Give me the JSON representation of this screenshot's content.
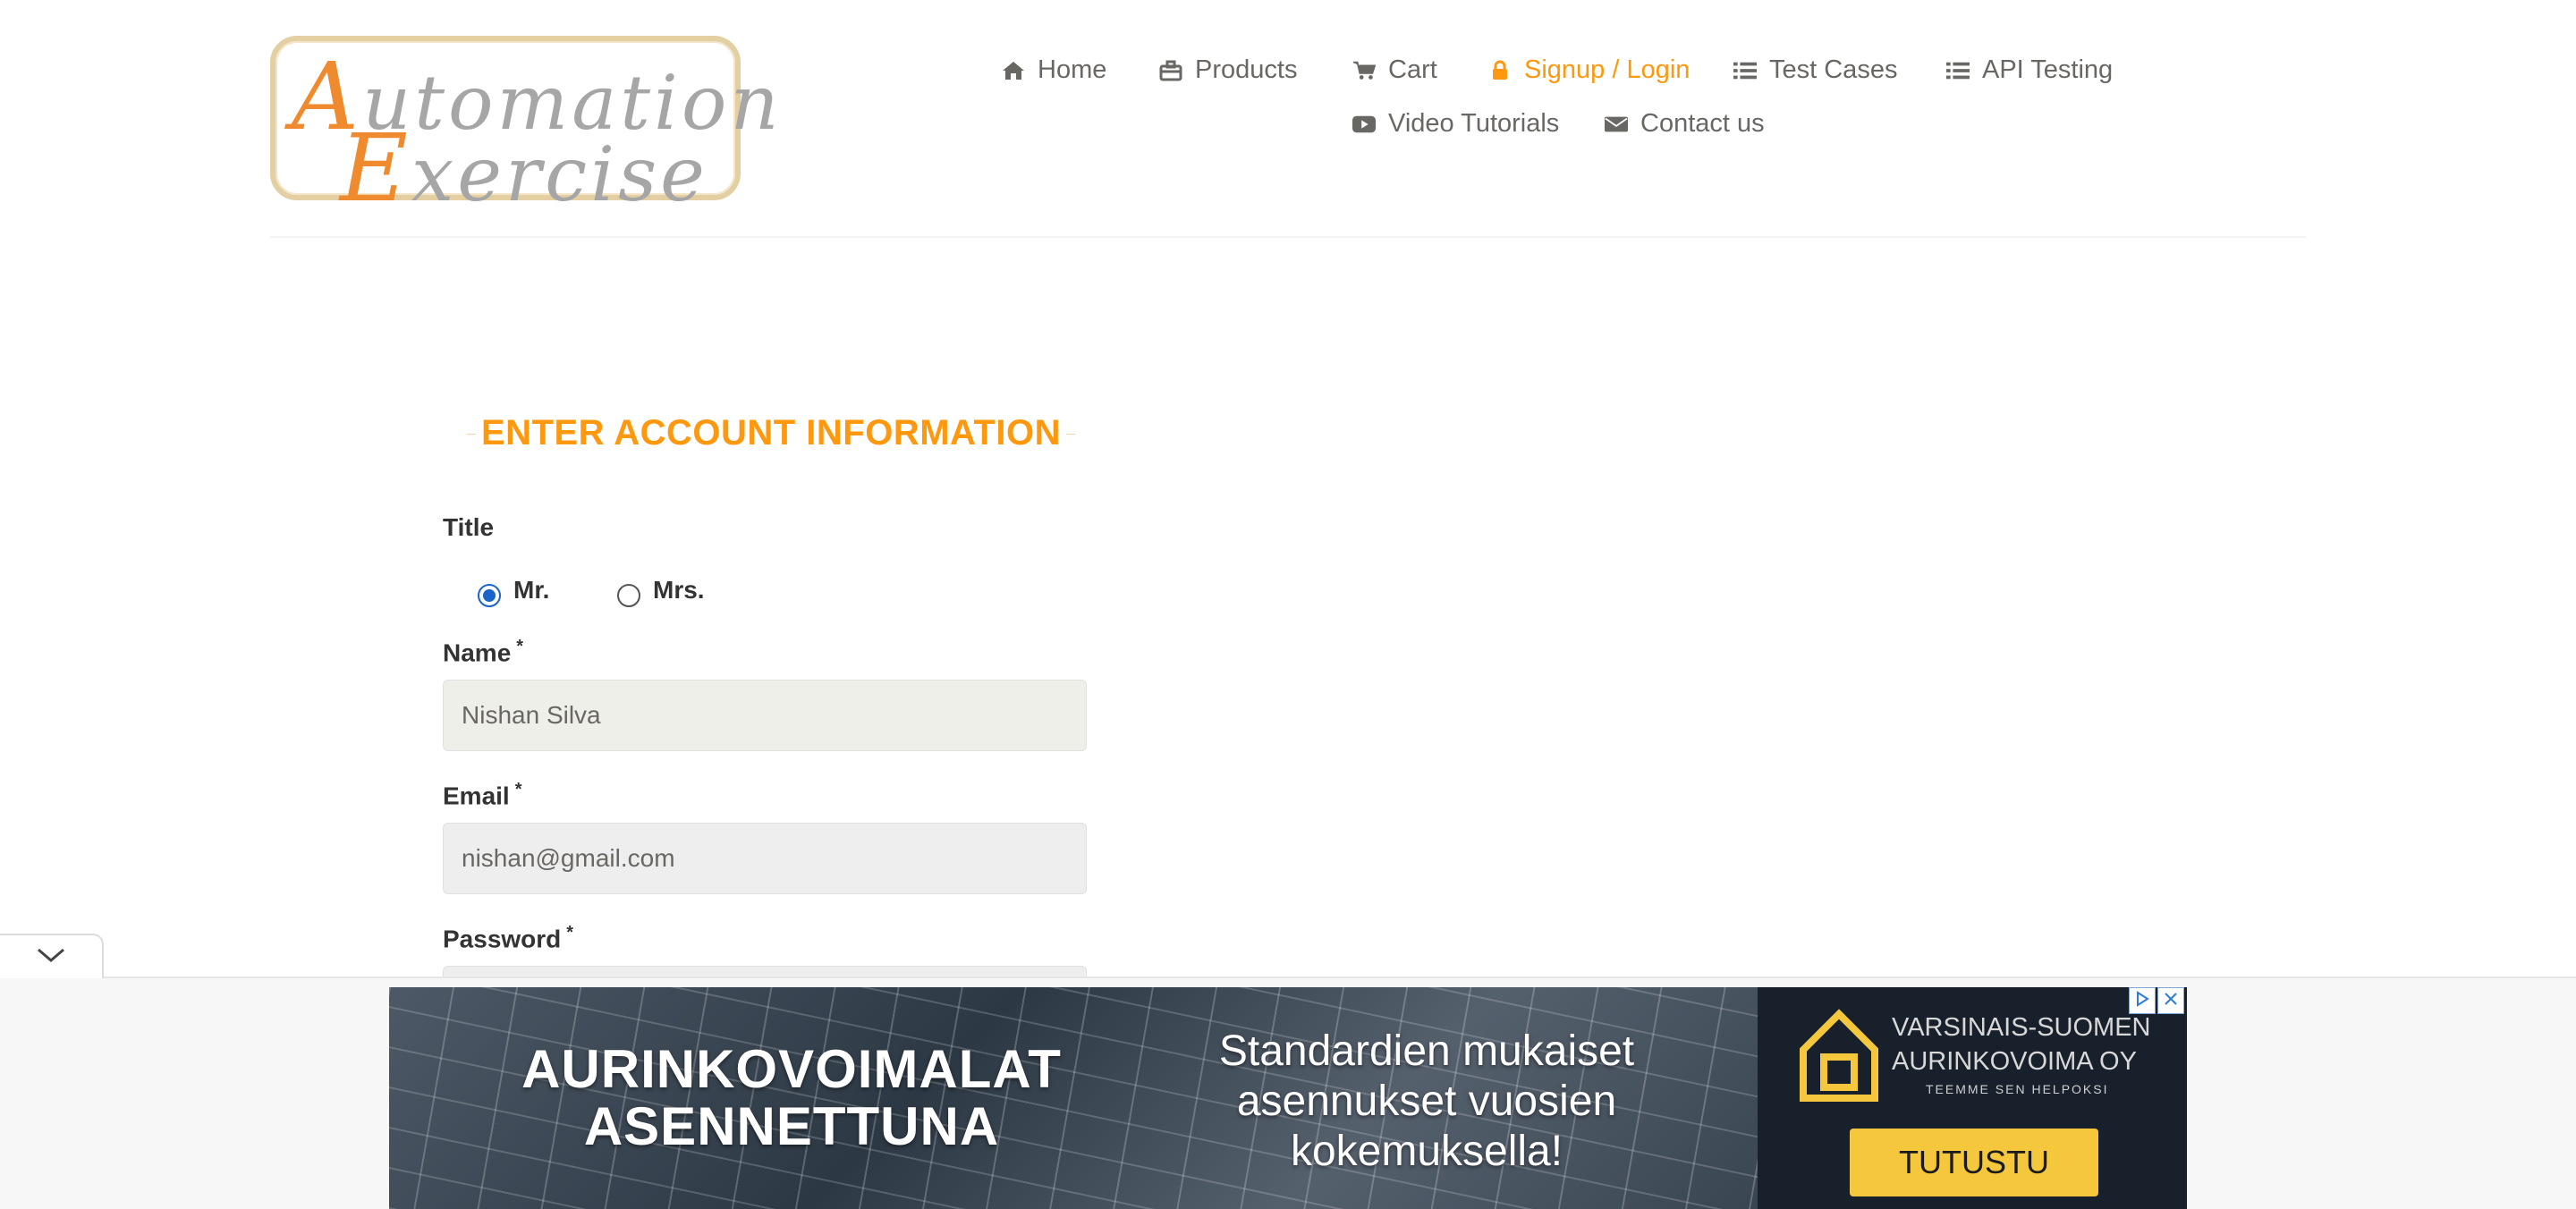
{
  "logo": {
    "line1_cap": "A",
    "line1_rest": "utomation",
    "line2_cap": "E",
    "line2_rest": "xercise"
  },
  "nav": {
    "items": [
      {
        "label": "Home",
        "icon": "home-icon"
      },
      {
        "label": "Products",
        "icon": "briefcase-icon"
      },
      {
        "label": "Cart",
        "icon": "cart-icon"
      },
      {
        "label": "Signup / Login",
        "icon": "lock-icon",
        "active": true
      },
      {
        "label": "Test Cases",
        "icon": "list-icon"
      },
      {
        "label": "API Testing",
        "icon": "list-icon"
      },
      {
        "label": "Video Tutorials",
        "icon": "youtube-play-icon"
      },
      {
        "label": "Contact us",
        "icon": "envelope-icon"
      }
    ],
    "active_color": "#fe980f"
  },
  "form": {
    "title": "ENTER ACCOUNT INFORMATION",
    "title_label": "Title",
    "options": [
      {
        "label": "Mr.",
        "checked": true
      },
      {
        "label": "Mrs.",
        "checked": false
      }
    ],
    "name_label": "Name",
    "name_value": "Nishan Silva",
    "email_label": "Email",
    "email_value": "nishan@gmail.com",
    "password_label": "Password",
    "required_mark": "*"
  },
  "ad": {
    "headline_line1": "AURINKOVOIMALAT",
    "headline_line2": "ASENNETTUNA",
    "subline_1": "Standardien mukaiset",
    "subline_2": "asennukset vuosien",
    "subline_3": "kokemuksella!",
    "brand_line1": "VARSINAIS-SUOMEN",
    "brand_line2": "AURINKOVOIMA OY",
    "brand_tagline": "TEEMME SEN HELPOKSI",
    "cta": "TUTUSTU",
    "cta_color": "#f4c73d"
  }
}
